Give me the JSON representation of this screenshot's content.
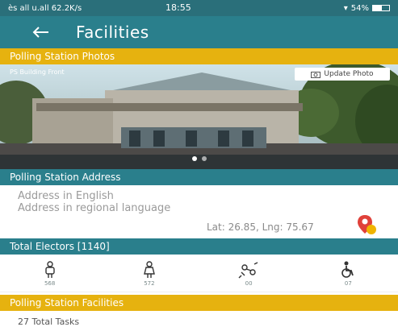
{
  "status_bar": {
    "left_text": "ès all u.all 62.2K/s",
    "time": "18:55",
    "right_text": "54%",
    "battery_level": 0.54
  },
  "app_bar": {
    "title": "Facilities"
  },
  "sections": {
    "photos": "Polling Station Photos",
    "address": "Polling Station Address",
    "electors": "Total Electors [1140]",
    "facilities": "Polling Station Facilities"
  },
  "photo": {
    "caption": "PS Building Front",
    "update_label": "Update Photo",
    "slide_count": 2,
    "active_slide": 1
  },
  "address": {
    "english": "Address in English",
    "regional": "Address in regional language",
    "latlng": "Lat: 26.85, Lng: 75.67"
  },
  "voters": [
    {
      "icon": "male-voter-icon",
      "count": "568"
    },
    {
      "icon": "female-voter-icon",
      "count": "572"
    },
    {
      "icon": "third-gender-icon",
      "count": "00"
    },
    {
      "icon": "disabled-voter-icon",
      "count": "07"
    }
  ],
  "facilities": {
    "summary": "27 Total Tasks"
  },
  "colors": {
    "teal": "#2a7f8c",
    "yellow": "#e6b20f",
    "pin_red": "#e0413a",
    "pin_yellow": "#f0b400"
  }
}
